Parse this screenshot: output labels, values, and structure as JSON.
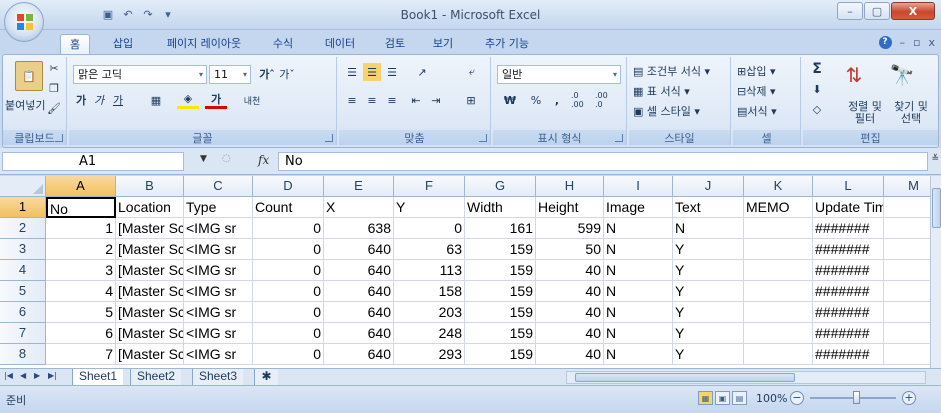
{
  "window": {
    "title": "Book1 - Microsoft Excel",
    "controls": {
      "minimize": "–",
      "maximize": "▢",
      "close": "X"
    }
  },
  "quick_access": {
    "save_icon": "save-icon",
    "undo_icon": "undo-icon",
    "redo_icon": "redo-icon"
  },
  "tabs": [
    {
      "label": "홈",
      "active": true
    },
    {
      "label": "삽입"
    },
    {
      "label": "페이지 레이아웃"
    },
    {
      "label": "수식"
    },
    {
      "label": "데이터"
    },
    {
      "label": "검토"
    },
    {
      "label": "보기"
    },
    {
      "label": "추가 기능"
    }
  ],
  "ribbon": {
    "clipboard": {
      "paste": "붙여넣기",
      "label": "클립보드"
    },
    "font": {
      "name": "맑은 고딕",
      "size": "11",
      "bold": "가",
      "italic": "가",
      "underline": "가",
      "font_color": "가",
      "phonetic": "내천",
      "label": "글꼴"
    },
    "alignment": {
      "label": "맞춤"
    },
    "number": {
      "format": "일반",
      "currency": "₩",
      "percent": "%",
      "comma": ",",
      "inc_dec": ".0 .00",
      "dec_dec": ".00 .0",
      "label": "표시 형식"
    },
    "styles": {
      "conditional": "조건부 서식",
      "table": "표 서식",
      "cell_style": "셀 스타일",
      "label": "스타일"
    },
    "cells": {
      "insert": "삽입",
      "delete": "삭제",
      "format": "서식",
      "label": "셀"
    },
    "editing": {
      "sort_filter": "정렬 및 필터",
      "find_select": "찾기 및 선택",
      "label": "편집"
    }
  },
  "formula_bar": {
    "name_box": "A1",
    "fx": "fx",
    "value": "No"
  },
  "columns": [
    "A",
    "B",
    "C",
    "D",
    "E",
    "F",
    "G",
    "H",
    "I",
    "J",
    "K",
    "L",
    "M"
  ],
  "rows": [
    {
      "n": "1",
      "cells": [
        "No",
        "Location",
        "Type",
        "Count",
        "X",
        "Y",
        "Width",
        "Height",
        "Image",
        "Text",
        "MEMO",
        "Update Time",
        ""
      ]
    },
    {
      "n": "2",
      "cells": [
        "1",
        "[Master Sc",
        "<IMG sr",
        "0",
        "638",
        "0",
        "161",
        "599",
        "N",
        "N",
        "",
        "#######",
        ""
      ]
    },
    {
      "n": "3",
      "cells": [
        "2",
        "[Master Sc",
        "<IMG sr",
        "0",
        "640",
        "63",
        "159",
        "50",
        "N",
        "Y",
        "",
        "#######",
        ""
      ]
    },
    {
      "n": "4",
      "cells": [
        "3",
        "[Master Sc",
        "<IMG sr",
        "0",
        "640",
        "113",
        "159",
        "40",
        "N",
        "Y",
        "",
        "#######",
        ""
      ]
    },
    {
      "n": "5",
      "cells": [
        "4",
        "[Master Sc",
        "<IMG sr",
        "0",
        "640",
        "158",
        "159",
        "40",
        "N",
        "Y",
        "",
        "#######",
        ""
      ]
    },
    {
      "n": "6",
      "cells": [
        "5",
        "[Master Sc",
        "<IMG sr",
        "0",
        "640",
        "203",
        "159",
        "40",
        "N",
        "Y",
        "",
        "#######",
        ""
      ]
    },
    {
      "n": "7",
      "cells": [
        "6",
        "[Master Sc",
        "<IMG sr",
        "0",
        "640",
        "248",
        "159",
        "40",
        "N",
        "Y",
        "",
        "#######",
        ""
      ]
    },
    {
      "n": "8",
      "cells": [
        "7",
        "[Master Sc",
        "<IMG sr",
        "0",
        "640",
        "293",
        "159",
        "40",
        "N",
        "Y",
        "",
        "#######",
        ""
      ]
    }
  ],
  "sheets": [
    {
      "label": "Sheet1",
      "active": true
    },
    {
      "label": "Sheet2"
    },
    {
      "label": "Sheet3"
    }
  ],
  "status": {
    "text": "준비",
    "zoom": "100%"
  },
  "colors": {
    "accent": "#c4d7ef",
    "selected_header": "#f1c15f",
    "grid_line": "#d0d7e5"
  }
}
